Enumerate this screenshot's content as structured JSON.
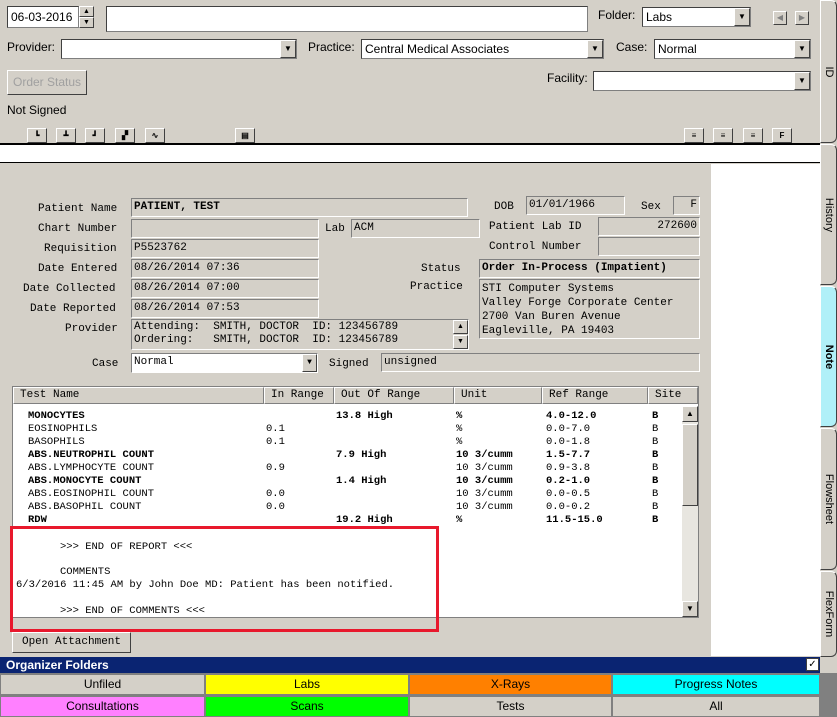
{
  "toolbar": {
    "date": "06-03-2016",
    "folder_label": "Folder:",
    "folder_value": "Labs",
    "provider_label": "Provider:",
    "practice_label": "Practice:",
    "practice_value": "Central Medical Associates",
    "case_label": "Case:",
    "case_value": "Normal",
    "order_status_label": "Order Status",
    "facility_label": "Facility:",
    "signed_status": "Not Signed"
  },
  "report": {
    "labels": {
      "patient_name": "Patient Name",
      "dob": "DOB",
      "sex": "Sex",
      "chart_number": "Chart Number",
      "lab": "Lab",
      "patient_lab_id": "Patient Lab ID",
      "requisition": "Requisition",
      "control_number": "Control Number",
      "date_entered": "Date Entered",
      "status": "Status",
      "date_collected": "Date Collected",
      "practice": "Practice",
      "date_reported": "Date Reported",
      "provider": "Provider",
      "case": "Case",
      "signed": "Signed"
    },
    "values": {
      "patient_name": "PATIENT, TEST",
      "dob": "01/01/1966",
      "sex": "F",
      "chart_number": "",
      "lab": "ACM",
      "patient_lab_id": "272600",
      "requisition": "P5523762",
      "control_number": "",
      "date_entered": "08/26/2014 07:36",
      "status": "Order In-Process (Impatient)",
      "date_collected": "08/26/2014 07:00",
      "date_reported": "08/26/2014 07:53",
      "practice_line1": "STI Computer Systems",
      "practice_line2": "Valley Forge Corporate Center",
      "practice_line3": "2700 Van Buren Avenue",
      "practice_line4": "Eagleville, PA 19403",
      "provider_line1": "Attending:  SMITH, DOCTOR  ID: 123456789",
      "provider_line2": "Ordering:   SMITH, DOCTOR  ID: 123456789",
      "case": "Normal",
      "signed": "unsigned"
    }
  },
  "table": {
    "headers": [
      "Test Name",
      "In Range",
      "Out Of Range",
      "Unit",
      "Ref Range",
      "Site"
    ],
    "rows": [
      {
        "name": "MONOCYTES",
        "in": "",
        "out": "13.8 High",
        "unit": "%",
        "ref": "4.0-12.0",
        "site": "B",
        "bold": true
      },
      {
        "name": "EOSINOPHILS",
        "in": "0.1",
        "out": "",
        "unit": "%",
        "ref": "0.0-7.0",
        "site": "B",
        "bold": false
      },
      {
        "name": "BASOPHILS",
        "in": "0.1",
        "out": "",
        "unit": "%",
        "ref": "0.0-1.8",
        "site": "B",
        "bold": false
      },
      {
        "name": "ABS.NEUTROPHIL COUNT",
        "in": "",
        "out": "7.9 High",
        "unit": "10 3/cumm",
        "ref": "1.5-7.7",
        "site": "B",
        "bold": true
      },
      {
        "name": "ABS.LYMPHOCYTE COUNT",
        "in": "0.9",
        "out": "",
        "unit": "10 3/cumm",
        "ref": "0.9-3.8",
        "site": "B",
        "bold": false
      },
      {
        "name": "ABS.MONOCYTE COUNT",
        "in": "",
        "out": "1.4 High",
        "unit": "10 3/cumm",
        "ref": "0.2-1.0",
        "site": "B",
        "bold": true
      },
      {
        "name": "ABS.EOSINOPHIL COUNT",
        "in": "0.0",
        "out": "",
        "unit": "10 3/cumm",
        "ref": "0.0-0.5",
        "site": "B",
        "bold": false
      },
      {
        "name": "ABS.BASOPHIL COUNT",
        "in": "0.0",
        "out": "",
        "unit": "10 3/cumm",
        "ref": "0.0-0.2",
        "site": "B",
        "bold": false
      },
      {
        "name": "RDW",
        "in": "",
        "out": "19.2 High",
        "unit": "%",
        "ref": "11.5-15.0",
        "site": "B",
        "bold": true
      }
    ]
  },
  "comments": {
    "end_report": ">>> END OF REPORT <<<",
    "heading": "COMMENTS",
    "text": "6/3/2016 11:45 AM by John Doe MD: Patient has been notified.",
    "end_comments": ">>> END OF COMMENTS <<<"
  },
  "open_attachment_label": "Open Attachment",
  "side_tabs": [
    "ID",
    "History",
    "Note",
    "Flowsheet",
    "FlexForm"
  ],
  "organizer": {
    "title": "Organizer Folders",
    "folders": [
      {
        "label": "Unfiled",
        "color": "#d4d0c8"
      },
      {
        "label": "Labs",
        "color": "#ffff00"
      },
      {
        "label": "X-Rays",
        "color": "#ff8000"
      },
      {
        "label": "Progress Notes",
        "color": "#00ffff"
      },
      {
        "label": "Consultations",
        "color": "#ff80ff"
      },
      {
        "label": "Scans",
        "color": "#00ff00"
      },
      {
        "label": "Tests",
        "color": "#d4d0c8"
      },
      {
        "label": "All",
        "color": "#d4d0c8"
      }
    ]
  }
}
